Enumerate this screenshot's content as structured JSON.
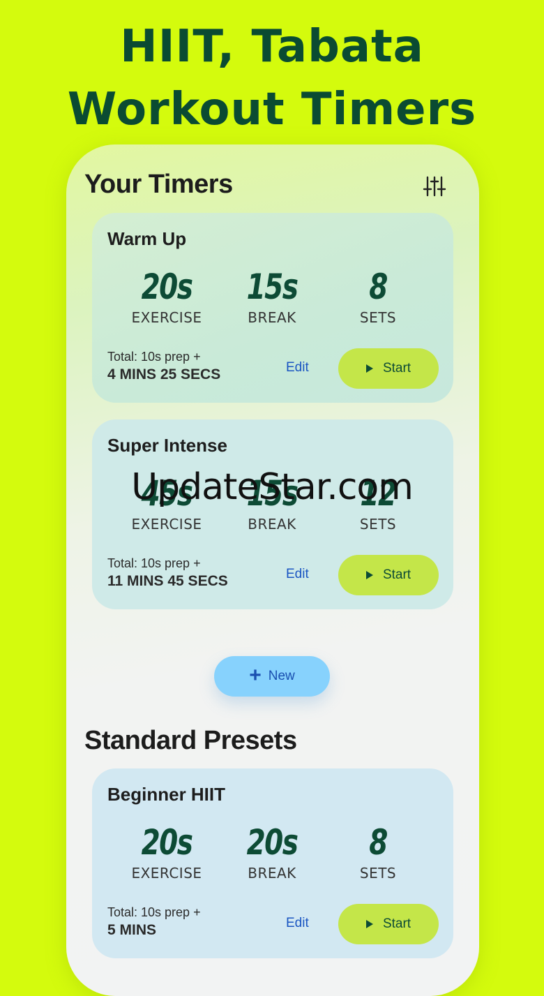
{
  "headline": {
    "line1": "HIIT, Tabata",
    "line2": "Workout Timers"
  },
  "your_timers": {
    "title": "Your Timers",
    "filter_icon": "sliders-icon",
    "timers": [
      {
        "name": "Warm Up",
        "exercise": "20s",
        "break": "15s",
        "sets": "8",
        "total_prefix": "Total: 10s prep +",
        "total": "4 MINS 25 SECS"
      },
      {
        "name": "Super Intense",
        "exercise": "45s",
        "break": "15s",
        "sets": "12",
        "total_prefix": "Total: 10s prep +",
        "total": "11 MINS 45 SECS"
      }
    ]
  },
  "labels": {
    "exercise": "EXERCISE",
    "break": "BREAK",
    "sets": "SETS",
    "edit": "Edit",
    "start": "Start"
  },
  "new_button": {
    "label": "New",
    "icon": "plus-icon"
  },
  "standard_presets": {
    "title": "Standard Presets",
    "presets": [
      {
        "name": "Beginner HIIT",
        "exercise": "20s",
        "break": "20s",
        "sets": "8",
        "total_prefix": "Total: 10s prep +",
        "total": "5 MINS"
      }
    ]
  },
  "watermark": "UpdateStar.com",
  "colors": {
    "background": "#d4fb0d",
    "headline": "#0a4b32",
    "start_button": "#c4e649",
    "new_button": "#87d2fd",
    "edit_link": "#1a55c2"
  }
}
